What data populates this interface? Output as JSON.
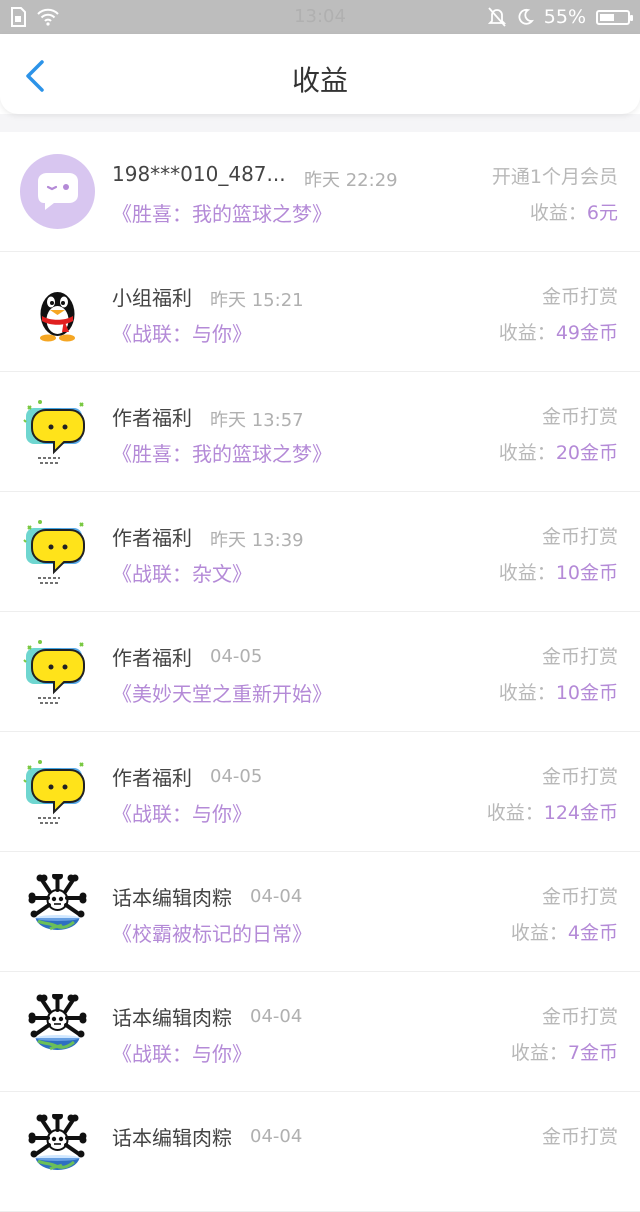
{
  "status_bar": {
    "time": "13:04",
    "battery": "55%",
    "battery_level": 0.55
  },
  "header": {
    "title": "收益"
  },
  "colors": {
    "accent": "#b48ad7",
    "back": "#2c93e8",
    "muted": "#b8b8b8"
  },
  "earnings_prefix": "收益：",
  "items": [
    {
      "avatar": "wechat-bubble-icon",
      "name": "198***010_487...",
      "time": "昨天 22:29",
      "book": "《胜喜：我的篮球之梦》",
      "type": "开通1个月会员",
      "amount": "6元"
    },
    {
      "avatar": "qq-penguin-icon",
      "name": "小组福利",
      "time": "昨天 15:21",
      "book": "《战联：与你》",
      "type": "金币打赏",
      "amount": "49金币"
    },
    {
      "avatar": "yellow-chat-icon",
      "name": "作者福利",
      "time": "昨天 13:57",
      "book": "《胜喜：我的篮球之梦》",
      "type": "金币打赏",
      "amount": "20金币"
    },
    {
      "avatar": "yellow-chat-icon",
      "name": "作者福利",
      "time": "昨天 13:39",
      "book": "《战联：杂文》",
      "type": "金币打赏",
      "amount": "10金币"
    },
    {
      "avatar": "yellow-chat-icon",
      "name": "作者福利",
      "time": "04-05",
      "book": "《美妙天堂之重新开始》",
      "type": "金币打赏",
      "amount": "10金币"
    },
    {
      "avatar": "yellow-chat-icon",
      "name": "作者福利",
      "time": "04-05",
      "book": "《战联：与你》",
      "type": "金币打赏",
      "amount": "124金币"
    },
    {
      "avatar": "earth-panda-icon",
      "name": "话本编辑肉粽",
      "time": "04-04",
      "book": "《校霸被标记的日常》",
      "type": "金币打赏",
      "amount": "4金币"
    },
    {
      "avatar": "earth-panda-icon",
      "name": "话本编辑肉粽",
      "time": "04-04",
      "book": "《战联：与你》",
      "type": "金币打赏",
      "amount": "7金币"
    },
    {
      "avatar": "earth-panda-icon",
      "name": "话本编辑肉粽",
      "time": "04-04",
      "book": "",
      "type": "金币打赏",
      "amount": ""
    }
  ]
}
